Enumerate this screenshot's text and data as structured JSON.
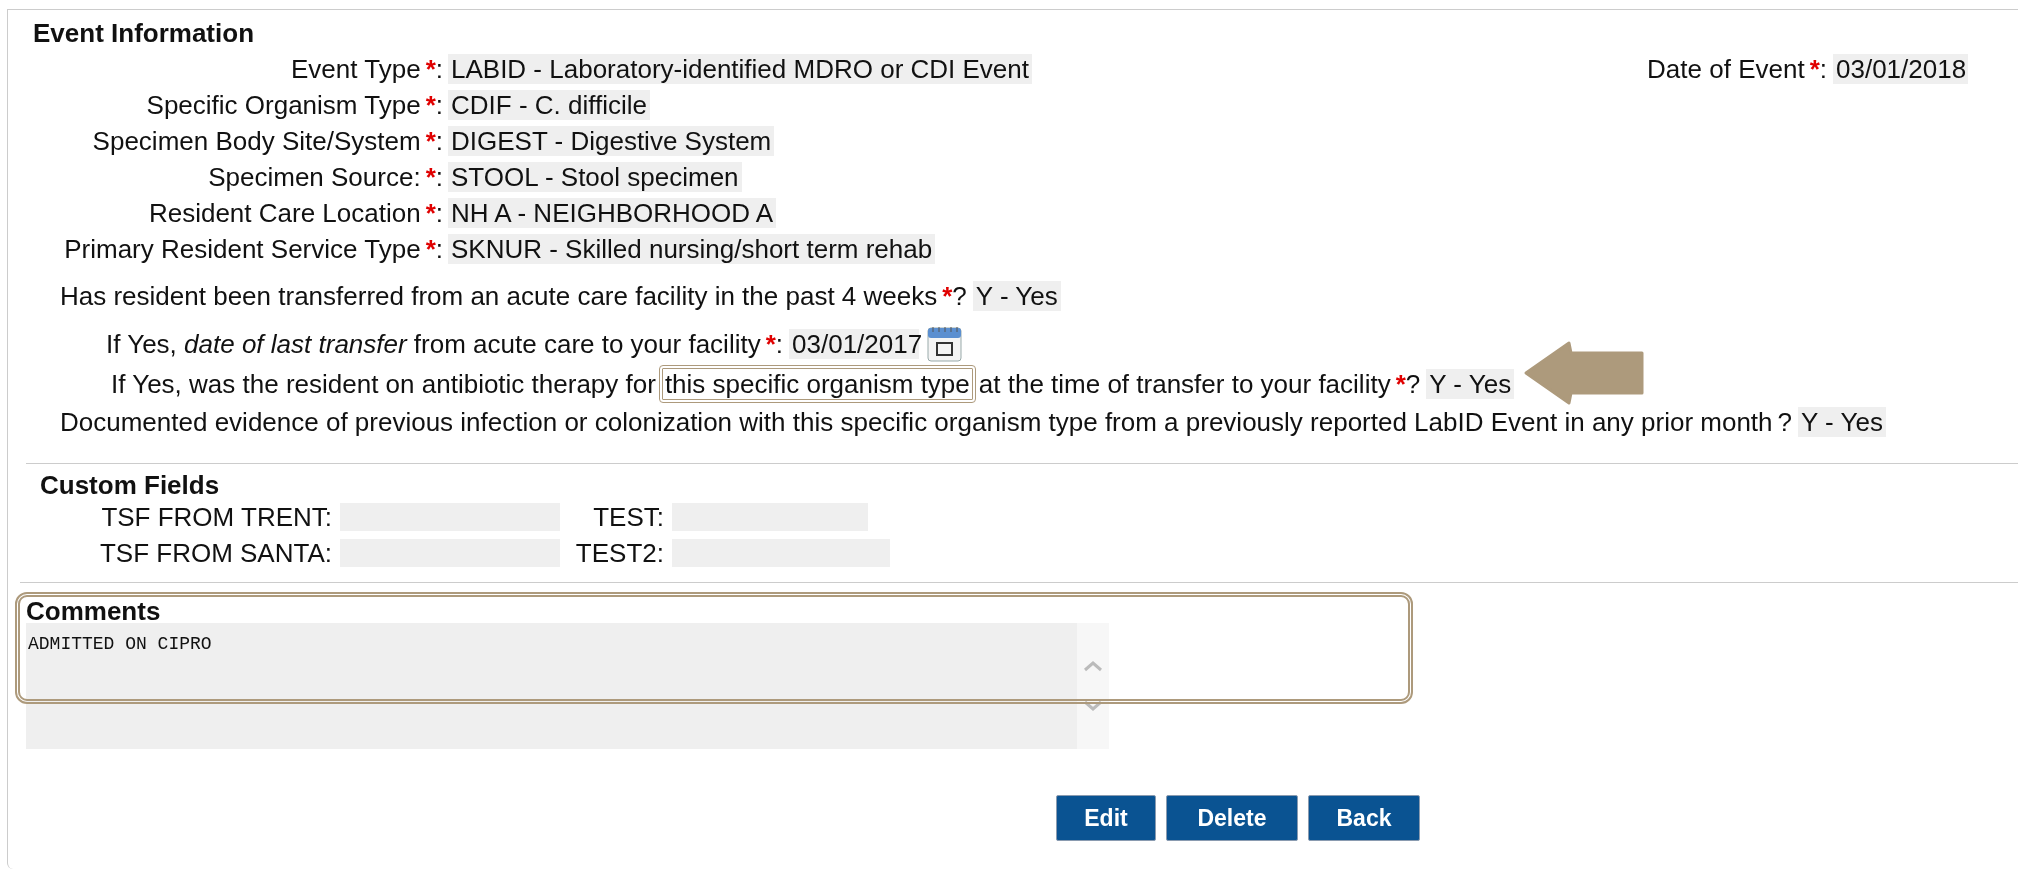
{
  "event_information": {
    "title": "Event Information",
    "fields": [
      {
        "label": "Event Type",
        "required_mark": "*",
        "suffix": ":",
        "value": "LABID - Laboratory-identified MDRO or CDI Event"
      },
      {
        "label": "Specific Organism Type",
        "required_mark": "*",
        "suffix": ":",
        "value": "CDIF - C. difficile"
      },
      {
        "label": "Specimen Body Site/System",
        "required_mark": "*",
        "suffix": ":",
        "value": "DIGEST - Digestive System"
      },
      {
        "label": "Specimen Source:",
        "required_mark": "*",
        "suffix": ":",
        "value": "STOOL - Stool specimen"
      },
      {
        "label": "Resident Care Location",
        "required_mark": "*",
        "suffix": ":",
        "value": "NH A - NEIGHBORHOOD A"
      },
      {
        "label": "Primary Resident Service Type",
        "required_mark": "*",
        "suffix": ":",
        "value": "SKNUR - Skilled nursing/short term rehab"
      }
    ],
    "date_of_event": {
      "label": "Date of Event",
      "required_mark": "*",
      "suffix": ":",
      "value": "03/01/2018"
    },
    "questions": [
      {
        "kind": "question",
        "text": "Has resident been transferred from an acute care facility in the past 4 weeks",
        "required_mark": "*",
        "suffix": "?",
        "value": "Y - Yes"
      },
      {
        "kind": "date",
        "text": "If Yes, *date of last transfer* from acute care to your facility",
        "required_mark": "*",
        "suffix": ":",
        "value": "03/01/2017"
      },
      {
        "kind": "highlighted",
        "text": "If Yes, was the resident on antibiotic therapy for",
        "highlight": "this specific organism type",
        "text_after": "at the time of transfer to your facility",
        "required_mark": "*",
        "suffix": "?",
        "value": "Y - Yes"
      },
      {
        "kind": "question",
        "text": "Documented evidence of previous infection or colonization with this specific organism type from a previously reported LabID Event in any prior month",
        "suffix": "?",
        "value": "Y - Yes"
      }
    ]
  },
  "custom_fields": {
    "title": "Custom Fields",
    "fields": [
      {
        "label": "TSF FROM TRENT:"
      },
      {
        "label": "TEST:"
      },
      {
        "label": "TSF FROM SANTA:"
      },
      {
        "label": "TEST2:"
      }
    ]
  },
  "comments": {
    "title": "Comments",
    "value": "ADMITTED ON CIPRO"
  },
  "buttons": [
    "Edit",
    "Delete",
    "Back"
  ]
}
